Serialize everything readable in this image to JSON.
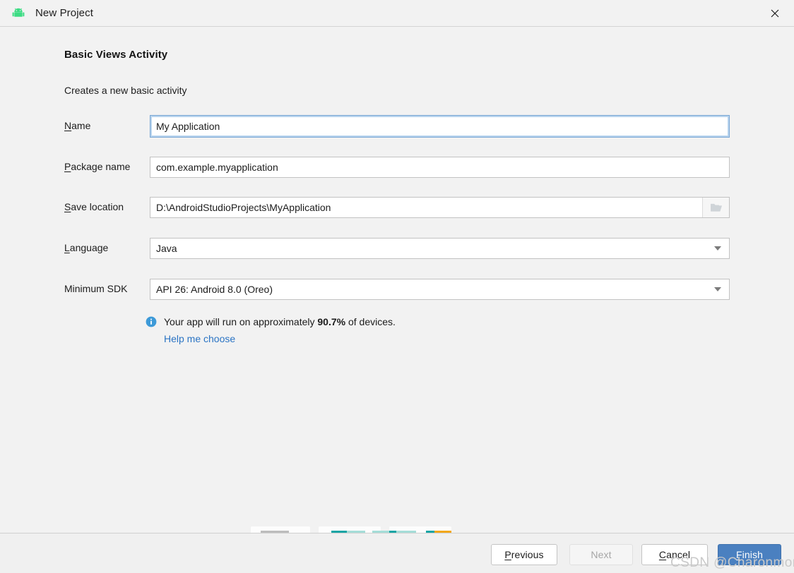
{
  "window": {
    "title": "New Project",
    "app_icon": "android-robot-icon",
    "close_icon": "close-icon"
  },
  "wizard": {
    "step_title": "Basic Views Activity",
    "step_description": "Creates a new basic activity"
  },
  "form": {
    "fields": [
      {
        "id": "name",
        "label": "Name",
        "mnemonic": "N",
        "value": "My Application",
        "type": "text",
        "focused": true
      },
      {
        "id": "package-name",
        "label": "Package name",
        "mnemonic": "P",
        "value": "com.example.myapplication",
        "type": "text",
        "focused": false
      },
      {
        "id": "save-location",
        "label": "Save location",
        "mnemonic": "S",
        "value": "D:\\AndroidStudioProjects\\MyApplication",
        "type": "text-with-browse",
        "browse_icon": "folder-icon",
        "focused": false
      },
      {
        "id": "language",
        "label": "Language",
        "mnemonic": "L",
        "value": "Java",
        "type": "combobox",
        "arrow_icon": "chevron-down-icon",
        "focused": false
      },
      {
        "id": "minimum-sdk",
        "label": "Minimum SDK",
        "mnemonic": "",
        "value": "API 26: Android 8.0 (Oreo)",
        "type": "combobox",
        "arrow_icon": "chevron-down-icon",
        "focused": false
      }
    ]
  },
  "info": {
    "icon": "info-icon",
    "text_before": "Your app will run on approximately ",
    "percent": "90.7%",
    "text_after": " of devices.",
    "link_label": "Help me choose",
    "link_color": "#2b74c4"
  },
  "footer": {
    "buttons": [
      {
        "id": "previous",
        "label": "Previous",
        "mnemonic": "P",
        "style": "default",
        "enabled": true
      },
      {
        "id": "next",
        "label": "Next",
        "mnemonic": "",
        "style": "disabled",
        "enabled": false
      },
      {
        "id": "cancel",
        "label": "Cancel",
        "mnemonic": "C",
        "style": "default",
        "enabled": true
      },
      {
        "id": "finish",
        "label": "Finish",
        "mnemonic": "F",
        "style": "primary",
        "enabled": true
      }
    ],
    "primary_color": "#4a80c0"
  },
  "watermark": {
    "text": "CSDN @Charonmomo"
  }
}
